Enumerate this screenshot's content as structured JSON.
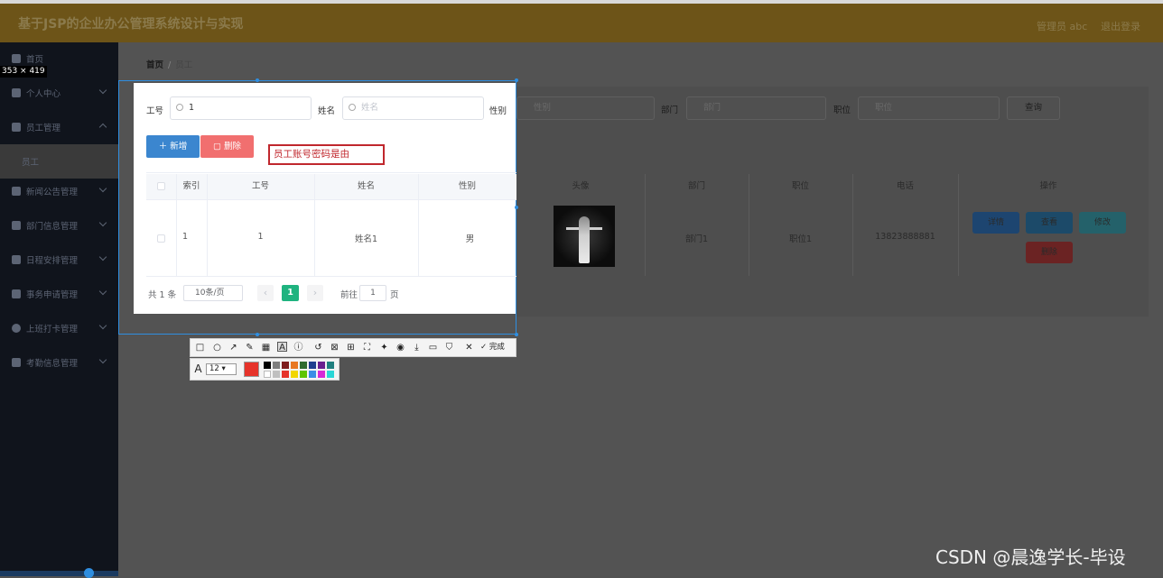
{
  "header": {
    "title": "基于JSP的企业办公管理系统设计与实现",
    "user": "管理员 abc",
    "logout": "退出登录"
  },
  "sidebar": {
    "items": [
      {
        "label": "首页"
      },
      {
        "label": "个人中心"
      },
      {
        "label": "员工管理"
      },
      {
        "label": "员工"
      },
      {
        "label": "新闻公告管理"
      },
      {
        "label": "部门信息管理"
      },
      {
        "label": "日程安排管理"
      },
      {
        "label": "事务申请管理"
      },
      {
        "label": "上班打卡管理"
      },
      {
        "label": "考勤信息管理"
      }
    ]
  },
  "breadcrumb": {
    "home": "首页",
    "sep": "/",
    "current": "员工"
  },
  "search": {
    "gonghao_label": "工号",
    "gonghao_value": "1",
    "xingming_label": "姓名",
    "xingming_placeholder": "姓名",
    "xingbie_label": "性别",
    "xingbie_placeholder": "性别",
    "bumen_label": "部门",
    "bumen_placeholder": "部门",
    "zhiwei_label": "职位",
    "zhiwei_placeholder": "职位",
    "query_button": "查询"
  },
  "actions": {
    "add": "新增",
    "delete": "删除"
  },
  "annotation": "员工账号密码是由",
  "table": {
    "headers": [
      "索引",
      "工号",
      "姓名",
      "性别",
      "头像",
      "部门",
      "职位",
      "电话",
      "操作"
    ],
    "row": {
      "index": "1",
      "gonghao": "1",
      "xingming": "姓名1",
      "xingbie": "男",
      "bumen": "部门1",
      "zhiwei": "职位1",
      "dianhua": "13823888881"
    },
    "row_actions": {
      "detail": "详情",
      "view": "查看",
      "edit": "修改",
      "delete": "删除"
    }
  },
  "pagination": {
    "total": "共 1 条",
    "page_size": "10条/页",
    "current": "1",
    "goto": "前往",
    "goto_value": "1",
    "page_unit": "页"
  },
  "capture": {
    "size_readout": "353 × 419",
    "font_size": "12",
    "done": "完成"
  },
  "watermark": "CSDN @晨逸学长-毕设",
  "colors": {
    "accent": "#3b86cf",
    "danger": "#f16f6f",
    "success": "#1fb37f",
    "annotation": "#c0272d",
    "selection": "#2f8ee0"
  }
}
